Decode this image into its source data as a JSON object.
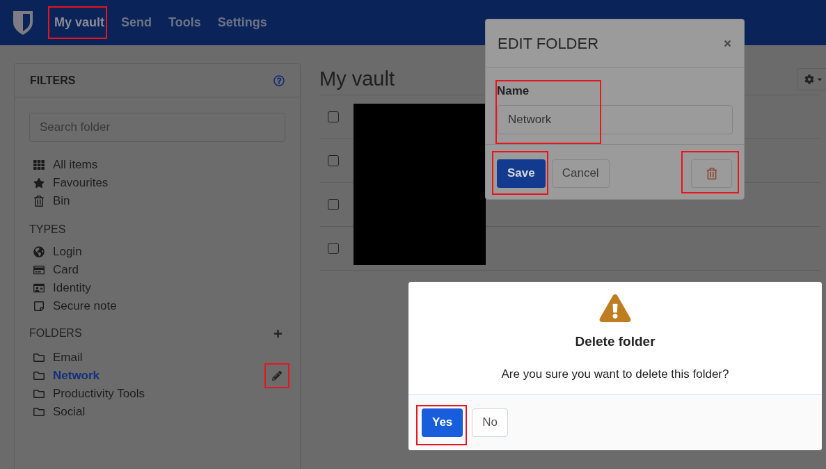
{
  "nav": {
    "items": [
      {
        "label": "My vault",
        "selected": true,
        "highlighted": true
      },
      {
        "label": "Send",
        "selected": false,
        "highlighted": false
      },
      {
        "label": "Tools",
        "selected": false,
        "highlighted": false
      },
      {
        "label": "Settings",
        "selected": false,
        "highlighted": false
      }
    ]
  },
  "filters": {
    "title": "FILTERS",
    "search": {
      "placeholder": "Search folder"
    },
    "items": [
      {
        "label": "All items",
        "kind": "grid"
      },
      {
        "label": "Favourites",
        "kind": "star"
      },
      {
        "label": "Bin",
        "kind": "bin"
      }
    ],
    "types": {
      "heading": "TYPES",
      "items": [
        {
          "label": "Login",
          "kind": "globe"
        },
        {
          "label": "Card",
          "kind": "card"
        },
        {
          "label": "Identity",
          "kind": "id"
        },
        {
          "label": "Secure note",
          "kind": "note"
        }
      ]
    },
    "folders": {
      "heading": "FOLDERS",
      "edit_highlighted": true,
      "items": [
        {
          "label": "Email",
          "selected": false
        },
        {
          "label": "Network",
          "selected": true
        },
        {
          "label": "Productivity Tools",
          "selected": false
        },
        {
          "label": "Social",
          "selected": false
        }
      ]
    }
  },
  "main": {
    "title": "My vault",
    "rows": [
      {
        "checked": false
      },
      {
        "checked": false
      },
      {
        "checked": false
      },
      {
        "checked": false
      }
    ]
  },
  "edit_folder": {
    "title": "EDIT FOLDER",
    "name_label": "Name",
    "name_value": "Network",
    "name_highlighted": true,
    "save": {
      "label": "Save",
      "highlighted": true
    },
    "cancel": {
      "label": "Cancel"
    },
    "delete_highlighted": true
  },
  "confirm": {
    "title": "Delete folder",
    "message": "Are you sure you want to delete this folder?",
    "yes": {
      "label": "Yes",
      "highlighted": true
    },
    "no": {
      "label": "No"
    }
  }
}
